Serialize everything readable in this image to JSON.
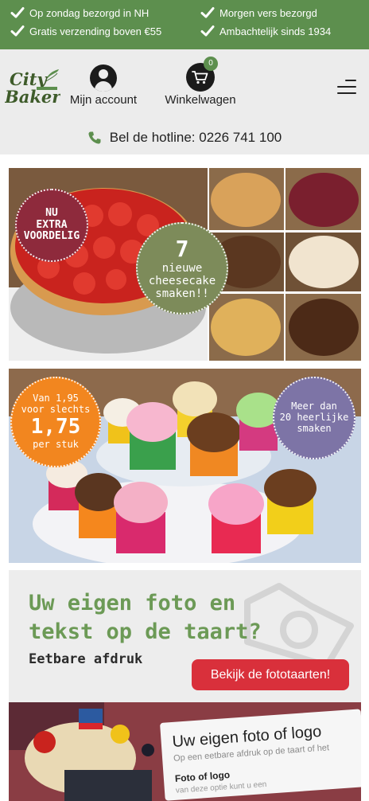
{
  "usp": {
    "items": [
      "Op zondag bezorgd in NH",
      "Morgen vers bezorgd",
      "Gratis verzending boven €55",
      "Ambachtelijk sinds 1934"
    ],
    "check_icon": "checkmark-icon"
  },
  "header": {
    "logo_text": [
      "City",
      "Bakery"
    ],
    "account_label": "Mijn account",
    "cart_label": "Winkelwagen",
    "cart_count": "0",
    "menu_icon": "hamburger-menu-icon"
  },
  "hotline": {
    "text": "Bel de hotline: 0226 741 100",
    "icon": "phone-icon"
  },
  "banner_cheesecake": {
    "stamp_left": [
      "NU",
      "EXTRA",
      "VOORDELIG"
    ],
    "stamp_right_number": "7",
    "stamp_right_lines": [
      "nieuwe",
      "cheesecake",
      "smaken!!"
    ]
  },
  "banner_cupcakes": {
    "price_lines": [
      "Van 1,95",
      "voor slechts"
    ],
    "price_big": "1,75",
    "price_unit": "per stuk",
    "flavours_lines": [
      "Meer dan",
      "20 heerlijke",
      "smaken"
    ]
  },
  "banner_photo_cake": {
    "heading_line1": "Uw eigen foto en",
    "heading_line2": "tekst op de taart?",
    "subheading": "Eetbare afdruk",
    "cta_label": "Bekijk de fototaarten!"
  },
  "banner_logo": {
    "card_title": "Uw eigen foto of logo",
    "card_sub": "Op een eetbare afdruk op de taart of het",
    "card_heading": "Foto of logo",
    "card_text": "van deze optie kunt u een"
  },
  "colors": {
    "brand_green": "#5d8f4e",
    "cta_red": "#d9303b",
    "stamp_burgundy": "#8e2a3c",
    "stamp_olive": "#7d8b5a",
    "stamp_orange": "#f2861f",
    "stamp_purple": "#7d74a6"
  }
}
